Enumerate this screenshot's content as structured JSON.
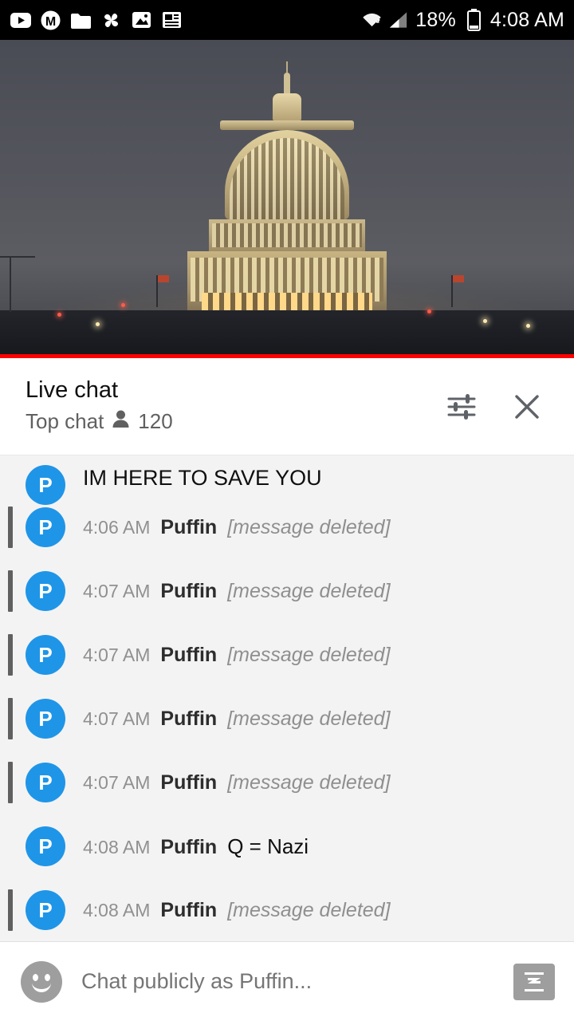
{
  "status_bar": {
    "left_icons": [
      "youtube-icon",
      "m-circle-icon",
      "folder-icon",
      "pinwheel-icon",
      "image-icon",
      "news-icon"
    ],
    "wifi_icon": "wifi-icon",
    "signal_icon": "cell-signal-icon",
    "battery_percent": "18%",
    "battery_icon": "battery-icon",
    "time": "4:08 AM"
  },
  "video": {
    "name": "live-video-player",
    "progress_percent": 100,
    "progress_color": "#ff0000"
  },
  "chat_header": {
    "title": "Live chat",
    "subtitle": "Top chat",
    "viewers_icon": "person-icon",
    "viewer_count": "120",
    "settings_icon": "chat-settings-icon",
    "close_icon": "close-icon"
  },
  "messages": [
    {
      "partial": true,
      "deleted": false,
      "avatar_letter": "P",
      "time": "",
      "author": "",
      "text": "IM HERE TO SAVE YOU"
    },
    {
      "partial": false,
      "deleted": true,
      "avatar_letter": "P",
      "time": "4:06 AM",
      "author": "Puffin",
      "text": "[message deleted]"
    },
    {
      "partial": false,
      "deleted": true,
      "avatar_letter": "P",
      "time": "4:07 AM",
      "author": "Puffin",
      "text": "[message deleted]"
    },
    {
      "partial": false,
      "deleted": true,
      "avatar_letter": "P",
      "time": "4:07 AM",
      "author": "Puffin",
      "text": "[message deleted]"
    },
    {
      "partial": false,
      "deleted": true,
      "avatar_letter": "P",
      "time": "4:07 AM",
      "author": "Puffin",
      "text": "[message deleted]"
    },
    {
      "partial": false,
      "deleted": true,
      "avatar_letter": "P",
      "time": "4:07 AM",
      "author": "Puffin",
      "text": "[message deleted]"
    },
    {
      "partial": false,
      "deleted": false,
      "avatar_letter": "P",
      "time": "4:08 AM",
      "author": "Puffin",
      "text": "Q = Nazi"
    },
    {
      "partial": false,
      "deleted": true,
      "avatar_letter": "P",
      "time": "4:08 AM",
      "author": "Puffin",
      "text": "[message deleted]"
    }
  ],
  "composer": {
    "emoji_icon": "emoji-icon",
    "placeholder": "Chat publicly as Puffin...",
    "value": "",
    "send_icon": "send-superchat-icon"
  },
  "colors": {
    "avatar_blue": "#1f95e8",
    "accent_red": "#ff0000",
    "deleted_gray": "#8f8f8f",
    "chat_bg": "#f3f3f3"
  }
}
